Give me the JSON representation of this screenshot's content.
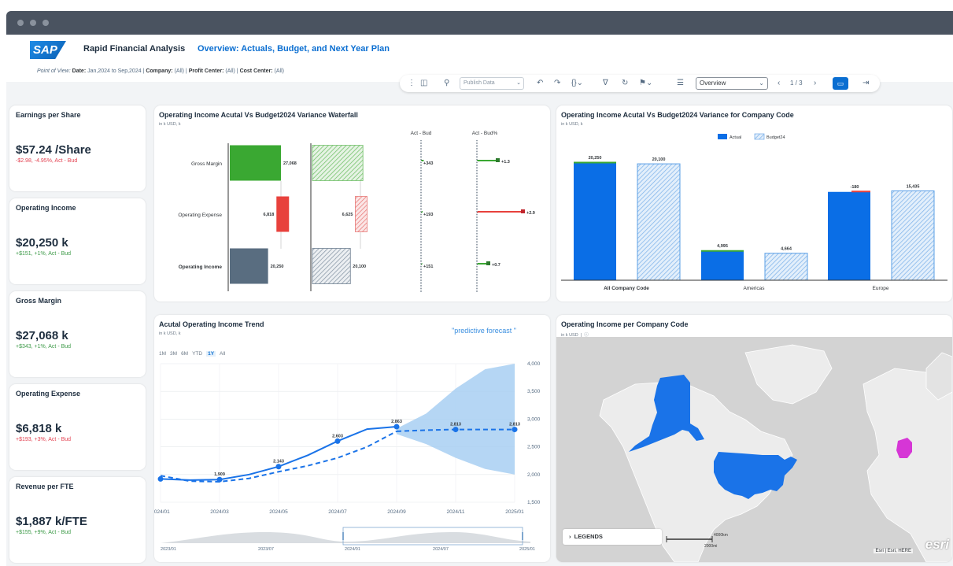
{
  "app": {
    "logo": "SAP",
    "title": "Rapid Financial Analysis",
    "subtitle": "Overview: Actuals, Budget, and Next Year Plan",
    "pov_label": "Point of View:",
    "pov_date_key": "Date:",
    "pov_date_val": "Jan,2024 to Sep,2024 |",
    "pov_company_key": "Company:",
    "pov_company_val": "(All) |",
    "pov_profit_key": "Profit Center:",
    "pov_profit_val": "(All) |",
    "pov_cost_key": "Cost Center:",
    "pov_cost_val": "(All)"
  },
  "toolbar": {
    "publish_label": "Publish Data",
    "page_select": "Overview",
    "page_indicator": "1 / 3"
  },
  "kpis": [
    {
      "title": "Earnings per Share",
      "value": "$57.24 /Share",
      "delta": "-$2.98, -4.95%, Act - Bud",
      "status": "neg"
    },
    {
      "title": "Operating Income",
      "value": "$20,250 k",
      "delta": "+$151, +1%, Act - Bud",
      "status": "pos"
    },
    {
      "title": "Gross Margin",
      "value": "$27,068 k",
      "delta": "+$343, +1%, Act - Bud",
      "status": "pos"
    },
    {
      "title": "Operating Expense",
      "value": "$6,818 k",
      "delta": "+$193, +3%, Act - Bud",
      "status": "neg"
    },
    {
      "title": "Revenue per FTE",
      "value": "$1,887 k/FTE",
      "delta": "+$155, +9%, Act - Bud",
      "status": "pos"
    }
  ],
  "colors": {
    "green": "#3aa832",
    "red": "#e8413c",
    "slate": "#596d80",
    "blue": "#0a6ee6",
    "lightblue": "#a8cff2",
    "accent": "#0a6ed1"
  },
  "waterfall": {
    "title": "Operating Income Acutal Vs Budget2024 Variance Waterfall",
    "unit": "in k USD, k",
    "col_act_bud": "Act - Bud",
    "col_act_bud_pct": "Act - Bud%",
    "chart_data": {
      "type": "bar",
      "categories": [
        "Gross Margin",
        "Operating Expense",
        "Operating Income"
      ],
      "series": [
        {
          "name": "Actual",
          "values": [
            27068,
            6818,
            20250
          ],
          "labels": [
            "27,068",
            "6,818",
            "20,250"
          ]
        },
        {
          "name": "Budget",
          "values": [
            26725,
            6625,
            20100
          ],
          "labels": [
            "",
            "6,625",
            "20,100"
          ]
        }
      ],
      "act_bud": [
        343,
        193,
        151
      ],
      "act_bud_labels": [
        "+343",
        "+193",
        "+151"
      ],
      "act_bud_pct": [
        1.3,
        2.9,
        0.7
      ],
      "act_bud_pct_labels": [
        "+1.3",
        "+2.9",
        "+0.7"
      ]
    }
  },
  "company": {
    "title": "Operating Income Acutal Vs Budget2024 Variance for Company Code",
    "unit": "in k USD, k",
    "chart_data": {
      "type": "bar",
      "categories": [
        "All Company Code",
        "Americas",
        "Europe"
      ],
      "series": [
        {
          "name": "Actual",
          "values": [
            20250,
            4995,
            15255
          ]
        },
        {
          "name": "Budget24",
          "values": [
            20100,
            4664,
            15435
          ]
        }
      ],
      "actual_labels": [
        "20,250",
        "4,995",
        ""
      ],
      "budget_labels": [
        "20,100",
        "4,664",
        "15,435"
      ],
      "variance_labels": [
        "",
        "",
        "-180"
      ]
    }
  },
  "trend": {
    "title": "Acutal Operating Income Trend",
    "unit": "in k USD, k",
    "forecast_label": "\"predictive forecast \"",
    "ranges": [
      "1M",
      "3M",
      "6M",
      "YTD",
      "1Y",
      "All"
    ],
    "selected_range": "1Y",
    "chart_data": {
      "type": "line",
      "x": [
        "2024/01",
        "2024/02",
        "2024/03",
        "2024/04",
        "2024/05",
        "2024/06",
        "2024/07",
        "2024/08",
        "2024/09",
        "2024/10",
        "2024/11",
        "2024/12",
        "2025/01"
      ],
      "x_tick_labels": [
        "2024/01",
        "2024/03",
        "2024/05",
        "2024/07",
        "2024/09",
        "2024/11",
        "2025/01"
      ],
      "series": [
        {
          "name": "Actual",
          "values": [
            1920,
            1900,
            1909,
            2000,
            2143,
            2350,
            2603,
            2820,
            2863,
            null,
            null,
            null,
            null
          ]
        },
        {
          "name": "Trend",
          "values": [
            1980,
            1880,
            1870,
            1930,
            2050,
            2160,
            2300,
            2500,
            2780,
            2800,
            2813,
            2813,
            2813
          ]
        },
        {
          "name": "Forecast",
          "values": [
            null,
            null,
            null,
            null,
            null,
            null,
            null,
            null,
            2780,
            2800,
            2813,
            2813,
            2813
          ]
        }
      ],
      "point_labels": [
        {
          "x": "2024/03",
          "y": 1909,
          "label": "1,909"
        },
        {
          "x": "2024/05",
          "y": 2143,
          "label": "2,143"
        },
        {
          "x": "2024/07",
          "y": 2603,
          "label": "2,603"
        },
        {
          "x": "2024/09",
          "y": 2863,
          "label": "2,863"
        },
        {
          "x": "2024/11",
          "y": 2813,
          "label": "2,813"
        },
        {
          "x": "2025/01",
          "y": 2813,
          "label": "2,813"
        }
      ],
      "forecast_band": {
        "x": [
          "2024/09",
          "2024/10",
          "2024/11",
          "2024/12",
          "2025/01"
        ],
        "upper": [
          2830,
          3100,
          3550,
          3900,
          4000
        ],
        "lower": [
          2730,
          2550,
          2300,
          2100,
          2000
        ]
      },
      "ylim": [
        1500,
        4000
      ],
      "y_ticks": [
        "4,000",
        "3,500",
        "3,000",
        "2,500",
        "2,000",
        "1,500"
      ],
      "navigator_labels": [
        "2023/01",
        "2023/07",
        "2024/01",
        "2024/07",
        "2025/01"
      ]
    }
  },
  "map": {
    "title": "Operating Income per Company Code",
    "unit": "in k USD",
    "legend_label": "LEGENDS",
    "scale_top": "4000km",
    "scale_bottom": "2000mi",
    "attribution": "Esri | Esri, HERE",
    "logo": "esri"
  }
}
